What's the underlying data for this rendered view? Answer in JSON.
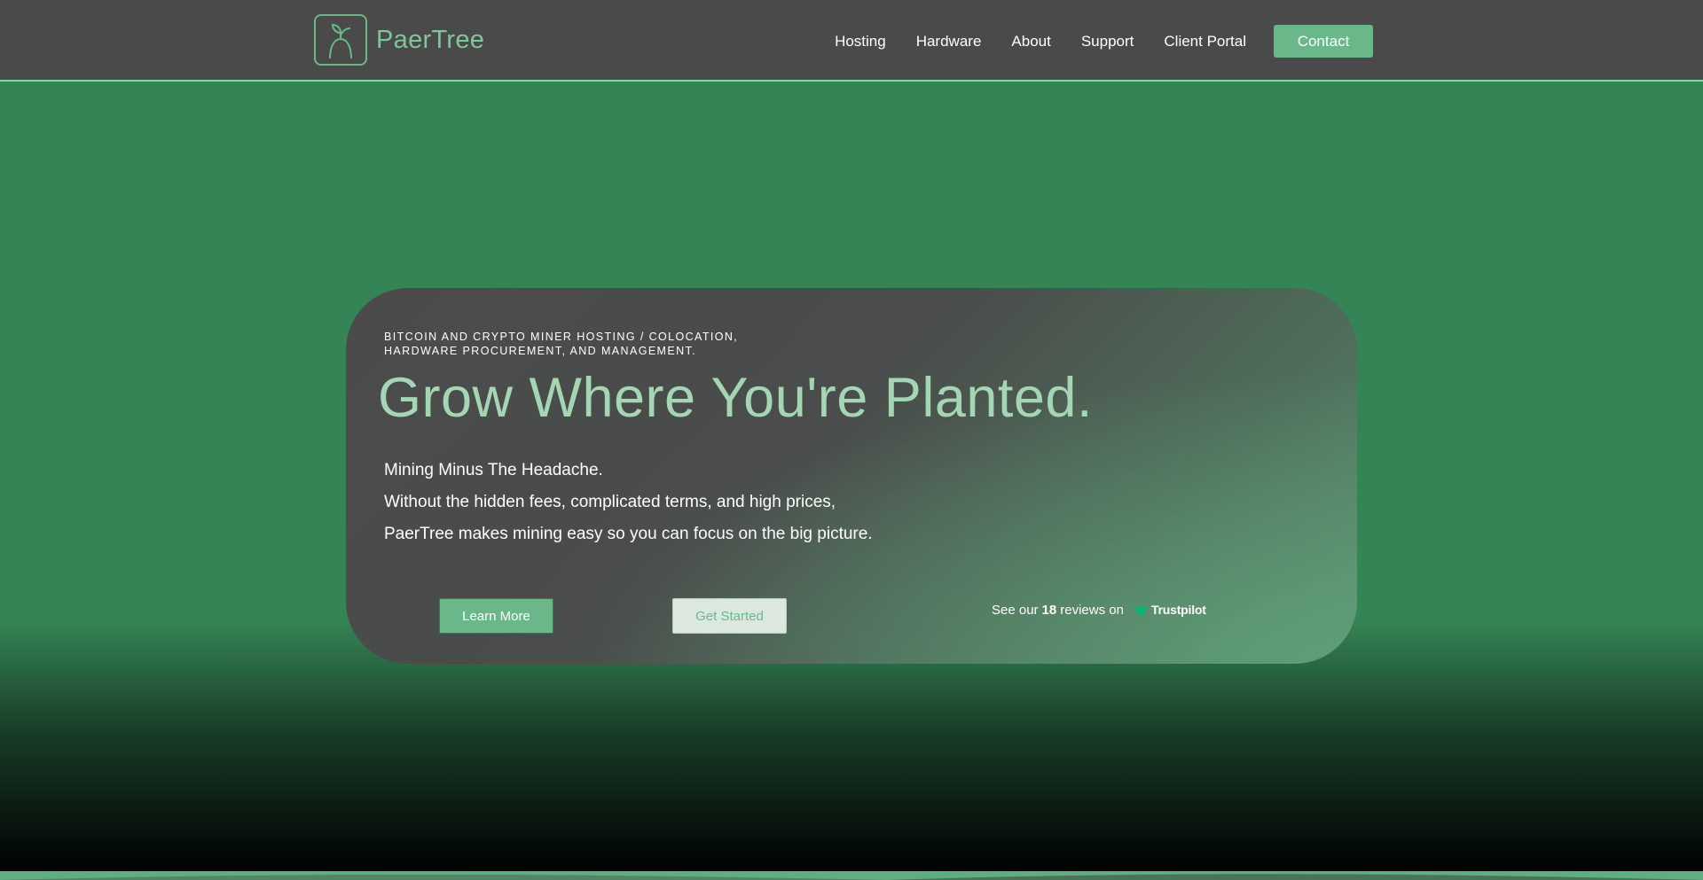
{
  "header": {
    "logo_text": "PaerTree",
    "nav": [
      {
        "label": "Hosting"
      },
      {
        "label": "Hardware"
      },
      {
        "label": "About"
      },
      {
        "label": "Support"
      },
      {
        "label": "Client Portal"
      }
    ],
    "contact_label": "Contact"
  },
  "hero": {
    "eyebrow_line1": "BITCOIN AND CRYPTO MINER HOSTING / COLOCATION,",
    "eyebrow_line2": "HARDWARE PROCUREMENT, AND MANAGEMENT.",
    "title": "Grow Where You're Planted.",
    "lines": [
      "Mining Minus The Headache.",
      "Without the hidden fees, complicated terms, and high prices,",
      "PaerTree makes mining easy so you can focus on the big picture."
    ],
    "learn_more_label": "Learn More",
    "get_started_label": "Get Started",
    "trustpilot": {
      "prefix": "See our",
      "count": "18",
      "suffix": "reviews on",
      "brand": "Trustpilot"
    }
  },
  "colors": {
    "background_green": "#358455",
    "header_gray": "#4a4a4a",
    "accent_green": "#6ab88a",
    "title_green": "#a4d6b4",
    "trustpilot_star": "#00b67a"
  },
  "icons": {
    "logo": "sprout-icon",
    "trustpilot": "star-icon"
  }
}
